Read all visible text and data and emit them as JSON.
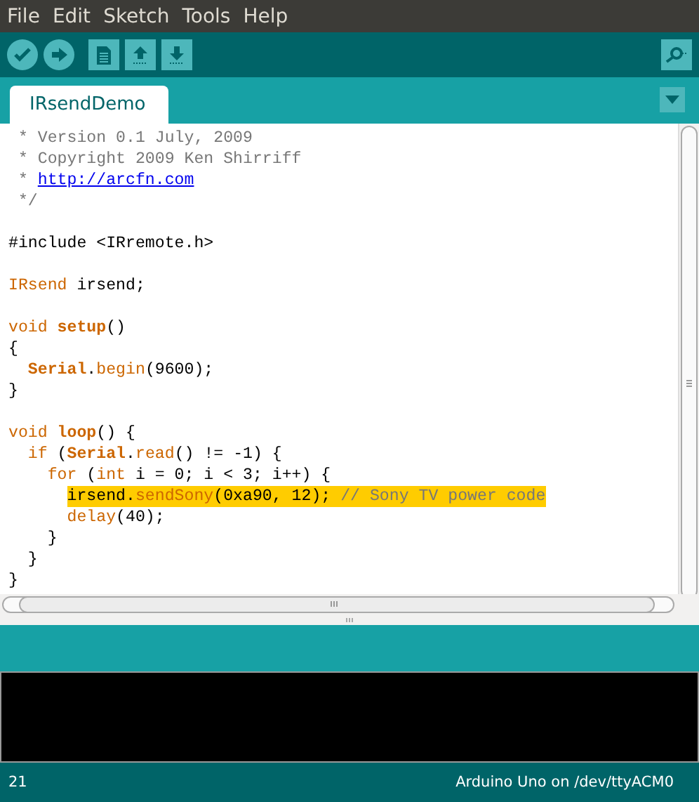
{
  "menu": [
    "File",
    "Edit",
    "Sketch",
    "Tools",
    "Help"
  ],
  "tabs": [
    {
      "label": "IRsendDemo",
      "selected": true
    }
  ],
  "code_lines": [
    {
      "highlighted": false,
      "tokens": [
        {
          "text": " * Version 0.1 July, 2009",
          "kind": "comment"
        }
      ]
    },
    {
      "highlighted": false,
      "tokens": [
        {
          "text": " * Copyright 2009 Ken Shirriff",
          "kind": "comment"
        }
      ]
    },
    {
      "highlighted": false,
      "tokens": [
        {
          "text": " * ",
          "kind": "comment"
        },
        {
          "text": "http://arcfn.com",
          "kind": "link"
        }
      ]
    },
    {
      "highlighted": false,
      "tokens": [
        {
          "text": " */",
          "kind": "comment"
        }
      ]
    },
    {
      "highlighted": false
    },
    {
      "highlighted": false,
      "tokens": [
        {
          "text": "#include <IRremote.h>",
          "kind": "plain"
        }
      ]
    },
    {
      "highlighted": false
    },
    {
      "highlighted": false,
      "tokens": [
        {
          "text": "IRsend",
          "kind": "keyword"
        },
        {
          "text": " irsend;",
          "kind": "plain"
        }
      ]
    },
    {
      "highlighted": false
    },
    {
      "highlighted": false,
      "tokens": [
        {
          "text": "void ",
          "kind": "keyword"
        },
        {
          "text": "setup",
          "kind": "function"
        },
        {
          "text": "()",
          "kind": "plain"
        }
      ]
    },
    {
      "highlighted": false,
      "tokens": [
        {
          "text": "{",
          "kind": "plain"
        }
      ]
    },
    {
      "highlighted": false,
      "tokens": [
        {
          "text": "  Serial",
          "kind": "function"
        },
        {
          "text": ".",
          "kind": "plain"
        },
        {
          "text": "begin",
          "kind": "method"
        },
        {
          "text": "(9600);",
          "kind": "plain"
        }
      ]
    },
    {
      "highlighted": false,
      "tokens": [
        {
          "text": "}",
          "kind": "plain"
        }
      ]
    },
    {
      "highlighted": false
    },
    {
      "highlighted": false,
      "tokens": [
        {
          "text": "void ",
          "kind": "keyword"
        },
        {
          "text": "loop",
          "kind": "function"
        },
        {
          "text": "() {",
          "kind": "plain"
        }
      ]
    },
    {
      "highlighted": false,
      "tokens": [
        {
          "text": "  if",
          "kind": "keyword"
        },
        {
          "text": " (",
          "kind": "plain"
        },
        {
          "text": "Serial",
          "kind": "function"
        },
        {
          "text": ".",
          "kind": "plain"
        },
        {
          "text": "read",
          "kind": "method"
        },
        {
          "text": "() != -1) {",
          "kind": "plain"
        }
      ]
    },
    {
      "highlighted": false,
      "tokens": [
        {
          "text": "    for",
          "kind": "keyword"
        },
        {
          "text": " (",
          "kind": "plain"
        },
        {
          "text": "int",
          "kind": "keyword"
        },
        {
          "text": " i = 0; i < 3; i++) {",
          "kind": "plain"
        }
      ]
    },
    {
      "highlighted": true,
      "tokens": [
        {
          "text": "      irsend.",
          "kind": "plain"
        },
        {
          "text": "sendSony",
          "kind": "method"
        },
        {
          "text": "(0xa90, 12); ",
          "kind": "plain"
        },
        {
          "text": "// Sony TV power code",
          "kind": "comment"
        }
      ]
    },
    {
      "highlighted": false,
      "tokens": [
        {
          "text": "      delay",
          "kind": "method"
        },
        {
          "text": "(40);",
          "kind": "plain"
        }
      ]
    },
    {
      "highlighted": false,
      "tokens": [
        {
          "text": "    }",
          "kind": "plain"
        }
      ]
    },
    {
      "highlighted": false,
      "tokens": [
        {
          "text": "  }",
          "kind": "plain"
        }
      ]
    },
    {
      "highlighted": false,
      "tokens": [
        {
          "text": "}",
          "kind": "plain"
        }
      ]
    }
  ],
  "status_bar": {
    "line": "21",
    "board": "Arduino Uno on /dev/ttyACM0"
  }
}
